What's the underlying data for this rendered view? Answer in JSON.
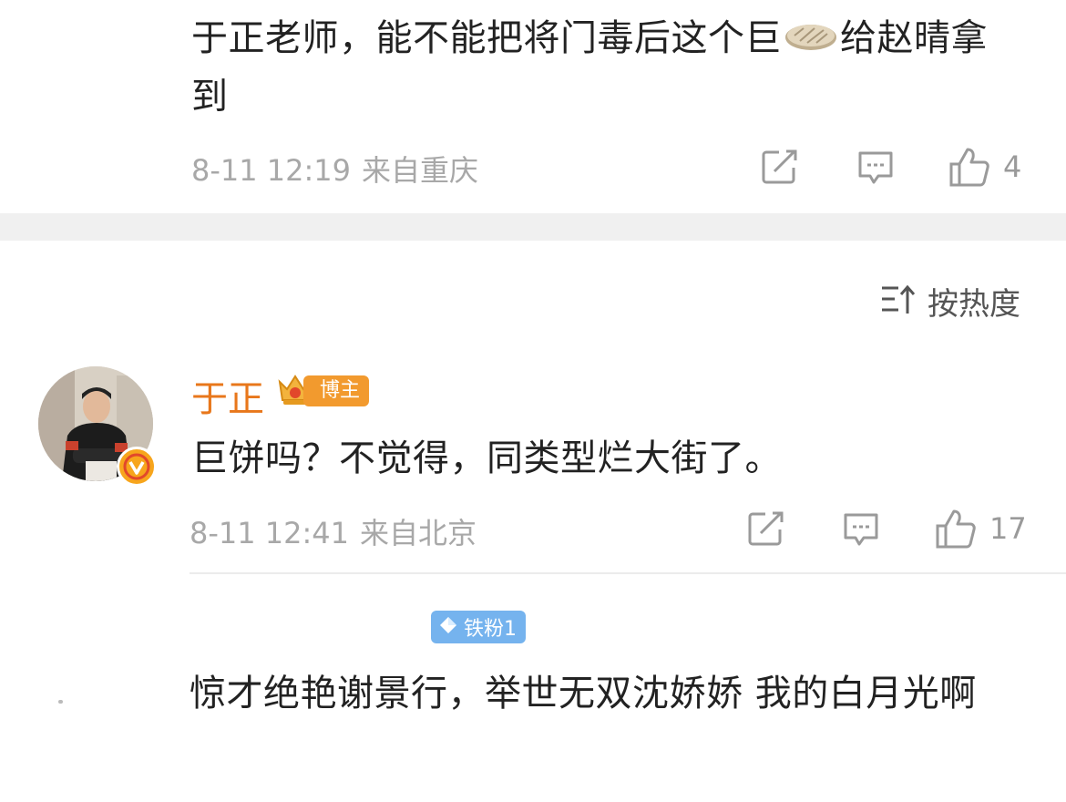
{
  "comment_1": {
    "text_before": "于正老师，能不能把将门毒后这个巨",
    "emoji": "cake-emoji",
    "text_after": "给赵晴拿到",
    "time": "8-11 12:19",
    "location": "来自重庆",
    "like_count": "4"
  },
  "sort": {
    "label": "按热度"
  },
  "comment_2": {
    "author": "于正",
    "author_badge": "博主",
    "text": "巨饼吗？不觉得，同类型烂大街了。",
    "time": "8-11 12:41",
    "location": "来自北京",
    "like_count": "17"
  },
  "comment_3": {
    "fan_badge": "铁粉1",
    "text": "惊才绝艳谢景行，举世无双沈娇娇 我的白月光啊"
  },
  "colors": {
    "author_name": "#e8771b",
    "meta_gray": "#a8a8a8",
    "separator": "#f0f0f0",
    "fan_badge": "#75b3ee",
    "verified": "#f7a51c"
  }
}
